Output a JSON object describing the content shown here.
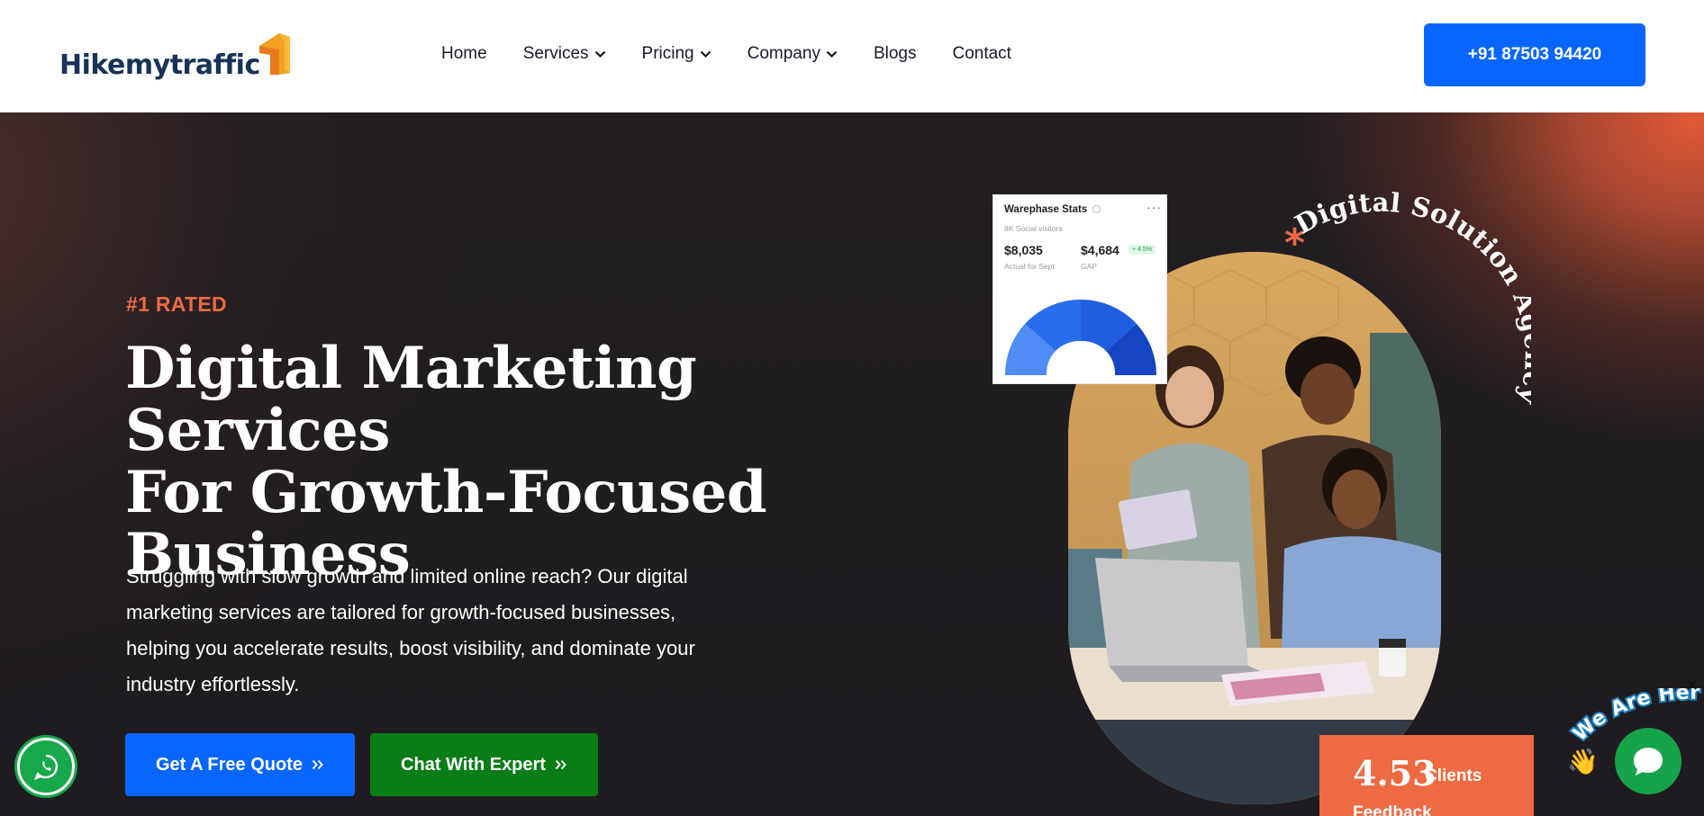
{
  "header": {
    "logo_text": "Hikemytraffic",
    "nav": [
      {
        "label": "Home",
        "dropdown": false
      },
      {
        "label": "Services",
        "dropdown": true
      },
      {
        "label": "Pricing",
        "dropdown": true
      },
      {
        "label": "Company",
        "dropdown": true
      },
      {
        "label": "Blogs",
        "dropdown": false
      },
      {
        "label": "Contact",
        "dropdown": false
      }
    ],
    "phone_label": "+91 87503 94420"
  },
  "hero": {
    "eyebrow": "#1 RATED",
    "headline_line1": "Digital Marketing Services",
    "headline_line2": "For Growth-Focused",
    "headline_line3": "Business",
    "description": "Struggling with slow growth and limited online reach? Our digital marketing services are tailored for growth-focused businesses, helping you accelerate results, boost visibility, and dominate your industry effortlessly.",
    "cta_quote": "Get A Free Quote",
    "cta_chat": "Chat With Expert"
  },
  "stats_card": {
    "title": "Warephase Stats",
    "subtitle": "8K Social visitors",
    "value1": "$8,035",
    "label1": "Actual for Sept",
    "value2": "$4,684",
    "label2": "GAP",
    "badge": "+ 4.5%"
  },
  "circular_text": "Digital Solution Agency",
  "rating": {
    "number": "4.53",
    "label": "Clients",
    "label2": "Feedback"
  },
  "chat_widget": {
    "tagline": "We Are Here!",
    "close_label": "✕"
  },
  "colors": {
    "primary_blue": "#0866ff",
    "green": "#0a7d16",
    "accent_orange": "#ec6a43",
    "hero_dark": "#1e1c20",
    "logo_navy": "#18325a"
  }
}
